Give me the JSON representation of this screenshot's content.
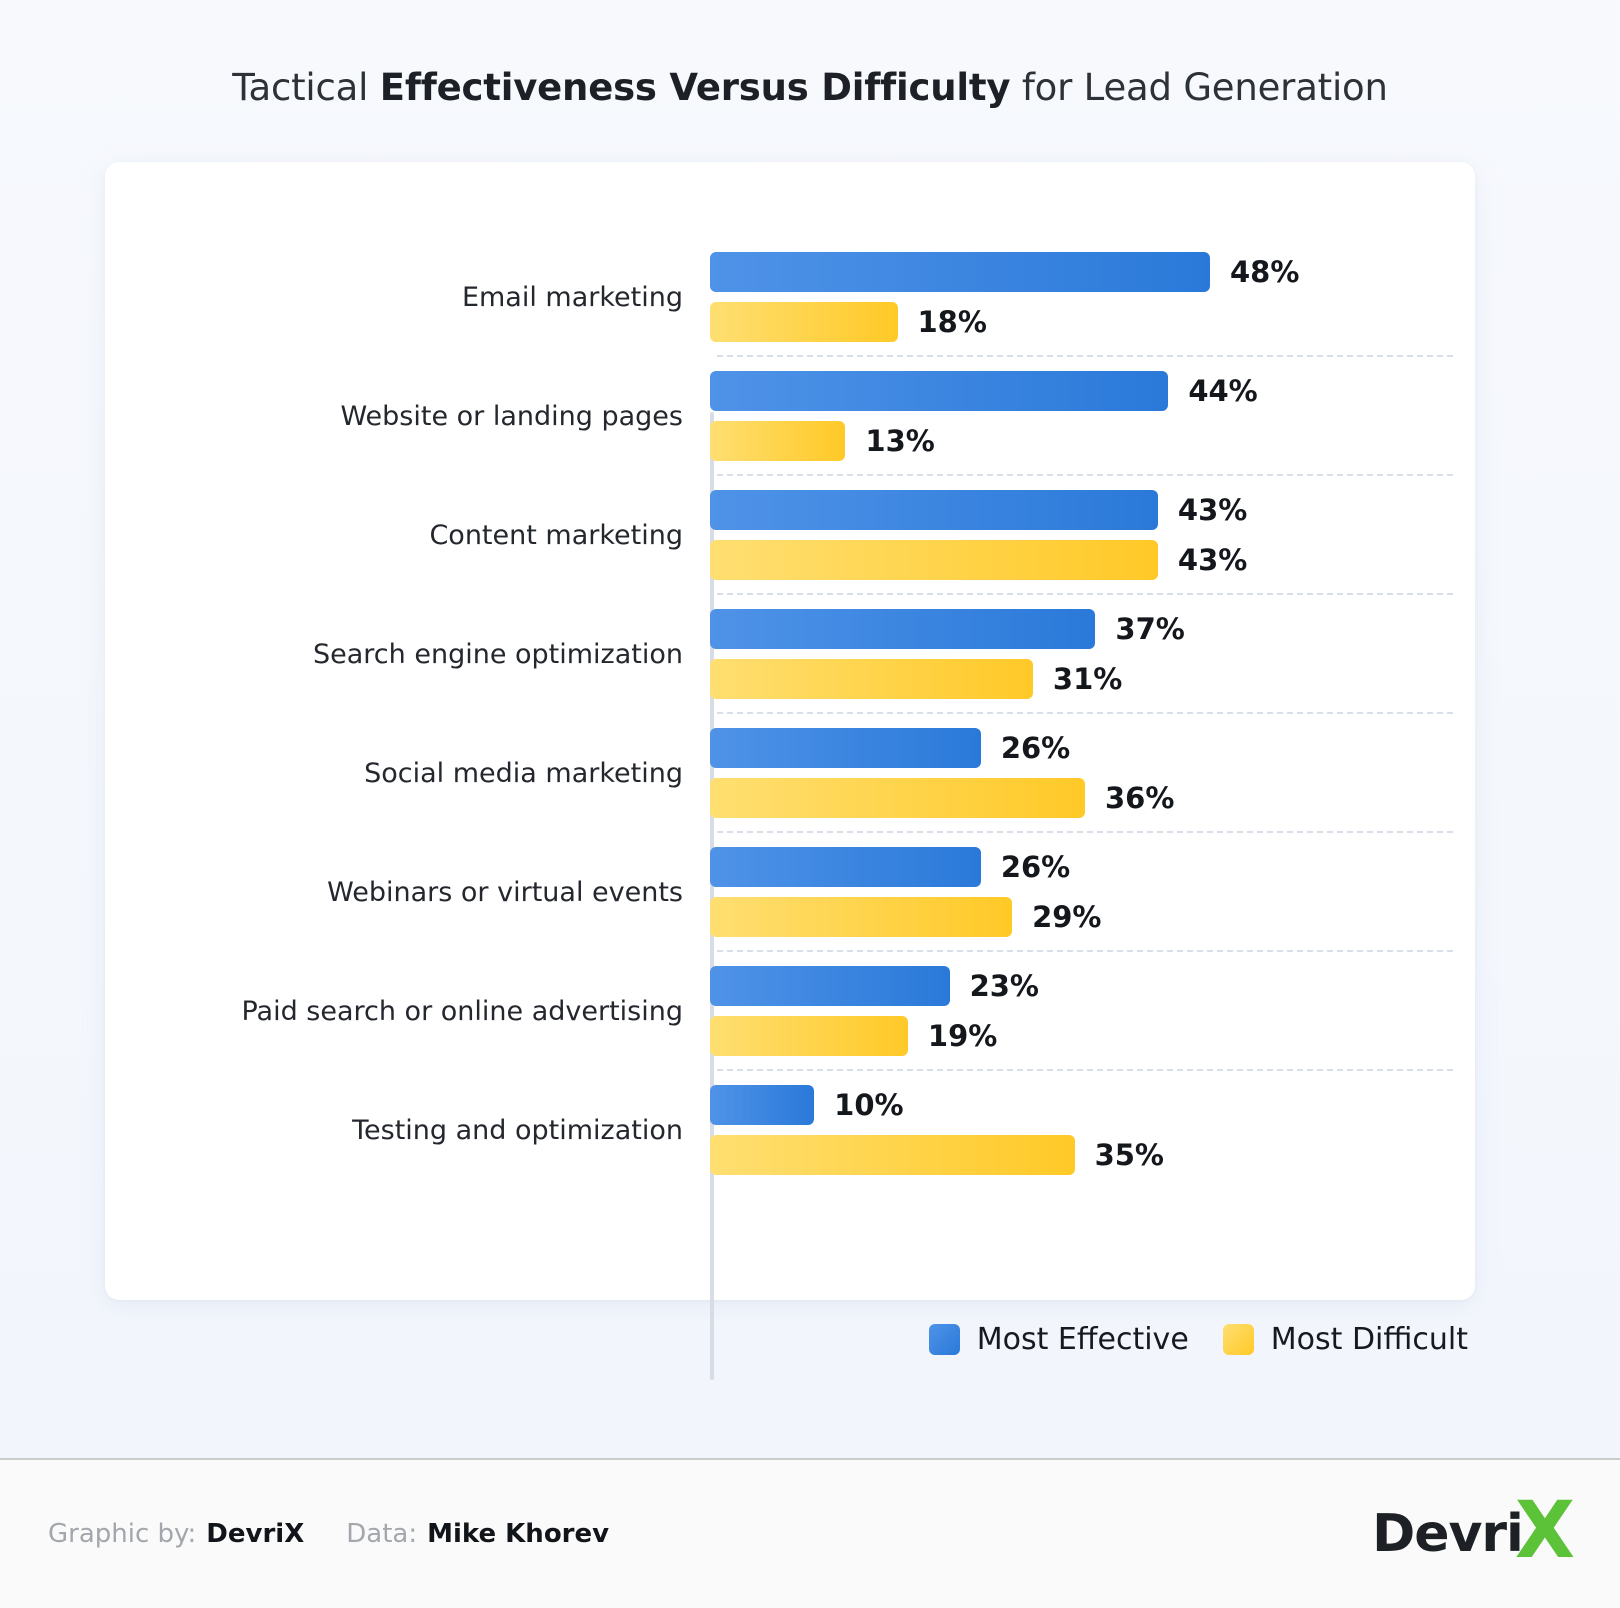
{
  "title": {
    "prefix": "Tactical ",
    "emphasis": "Effectiveness Versus Difficulty",
    "suffix": " for Lead Generation"
  },
  "legend": {
    "items": [
      {
        "label": "Most Effective",
        "color": "#2a79d9",
        "swatch": "blue"
      },
      {
        "label": "Most Difficult",
        "color": "#ffc927",
        "swatch": "yellow"
      }
    ]
  },
  "footer": {
    "graphic_by_key": "Graphic by:",
    "graphic_by_value": "DevriX",
    "data_key": "Data:",
    "data_value": "Mike Khorev",
    "logo_main": "Devri",
    "logo_accent": "X"
  },
  "chart_data": {
    "type": "bar",
    "orientation": "horizontal",
    "title": "Tactical Effectiveness Versus Difficulty for Lead Generation",
    "xlabel": "",
    "ylabel": "",
    "xlim": [
      0,
      48
    ],
    "grid": "horizontal-dashed-separators",
    "legend_position": "bottom-right",
    "value_suffix": "%",
    "categories": [
      "Email marketing",
      "Website or landing pages",
      "Content marketing",
      "Search engine optimization",
      "Social media marketing",
      "Webinars or virtual events",
      "Paid search or online advertising",
      "Testing and optimization"
    ],
    "series": [
      {
        "name": "Most Effective",
        "color": "#2a79d9",
        "values": [
          48,
          44,
          43,
          37,
          26,
          26,
          23,
          10
        ],
        "labels": [
          "48%",
          "44%",
          "43%",
          "37%",
          "26%",
          "26%",
          "23%",
          "10%"
        ]
      },
      {
        "name": "Most Difficult",
        "color": "#ffc927",
        "values": [
          18,
          13,
          43,
          31,
          36,
          29,
          19,
          35
        ],
        "labels": [
          "18%",
          "13%",
          "43%",
          "31%",
          "36%",
          "29%",
          "19%",
          "35%"
        ]
      }
    ]
  }
}
